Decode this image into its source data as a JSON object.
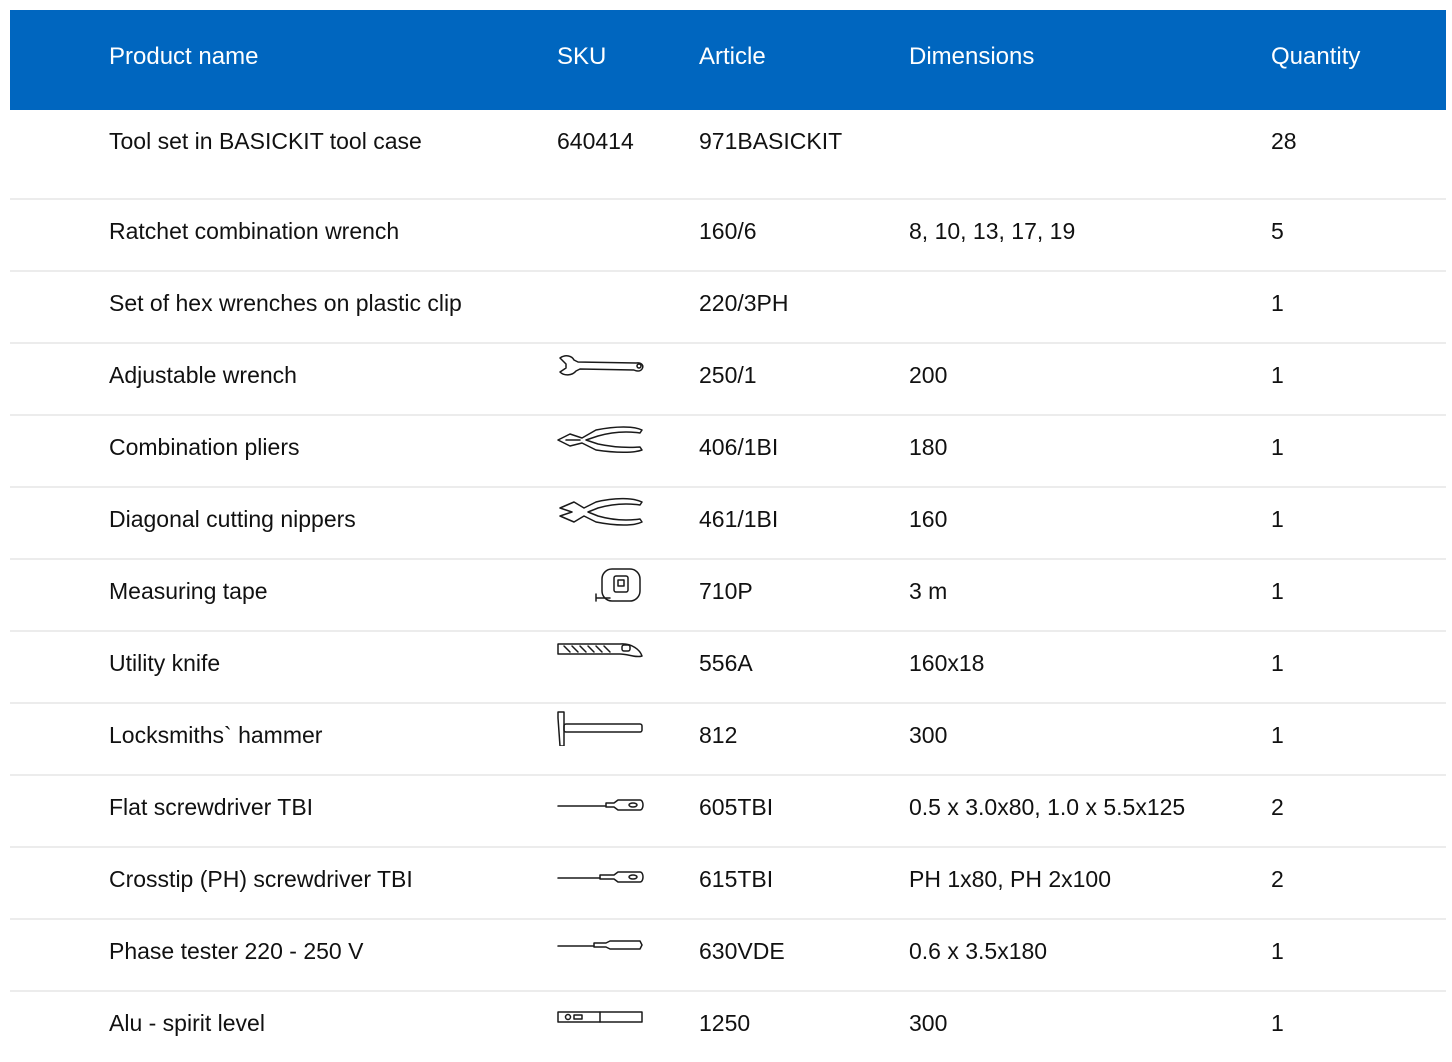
{
  "headers": {
    "product_name": "Product name",
    "sku": "SKU",
    "article": "Article",
    "dimensions": "Dimensions",
    "quantity": "Quantity"
  },
  "rows": [
    {
      "name": "Tool set in BASICKIT tool case",
      "sku": "640414",
      "article": "971BASICKIT",
      "dimensions": "",
      "quantity": "28",
      "icon": ""
    },
    {
      "name": "Ratchet combination wrench",
      "sku": "",
      "article": "160/6",
      "dimensions": "8, 10, 13, 17, 19",
      "quantity": "5",
      "icon": ""
    },
    {
      "name": "Set of hex wrenches on plastic clip",
      "sku": "",
      "article": "220/3PH",
      "dimensions": "",
      "quantity": "1",
      "icon": ""
    },
    {
      "name": "Adjustable wrench",
      "sku": "",
      "article": "250/1",
      "dimensions": "200",
      "quantity": "1",
      "icon": "adjustable-wrench-icon"
    },
    {
      "name": "Combination pliers",
      "sku": "",
      "article": "406/1BI",
      "dimensions": "180",
      "quantity": "1",
      "icon": "combination-pliers-icon"
    },
    {
      "name": "Diagonal cutting nippers",
      "sku": "",
      "article": "461/1BI",
      "dimensions": "160",
      "quantity": "1",
      "icon": "diagonal-nippers-icon"
    },
    {
      "name": "Measuring tape",
      "sku": "",
      "article": "710P",
      "dimensions": "3 m",
      "quantity": "1",
      "icon": "measuring-tape-icon"
    },
    {
      "name": "Utility knife",
      "sku": "",
      "article": "556A",
      "dimensions": "160x18",
      "quantity": "1",
      "icon": "utility-knife-icon"
    },
    {
      "name": "Locksmiths` hammer",
      "sku": "",
      "article": "812",
      "dimensions": "300",
      "quantity": "1",
      "icon": "hammer-icon"
    },
    {
      "name": "Flat screwdriver TBI",
      "sku": "",
      "article": "605TBI",
      "dimensions": "0.5 x 3.0x80, 1.0 x 5.5x125",
      "quantity": "2",
      "icon": "flat-screwdriver-icon"
    },
    {
      "name": "Crosstip (PH) screwdriver TBI",
      "sku": "",
      "article": "615TBI",
      "dimensions": "PH 1x80, PH 2x100",
      "quantity": "2",
      "icon": "crosstip-screwdriver-icon"
    },
    {
      "name": "Phase tester 220 - 250 V",
      "sku": "",
      "article": "630VDE",
      "dimensions": "0.6 x 3.5x180",
      "quantity": "1",
      "icon": "phase-tester-icon"
    },
    {
      "name": "Alu - spirit level",
      "sku": "",
      "article": "1250",
      "dimensions": "300",
      "quantity": "1",
      "icon": "spirit-level-icon"
    }
  ],
  "colors": {
    "header_bg": "#0066bf",
    "header_text": "#ffffff",
    "divider": "#ececec"
  }
}
